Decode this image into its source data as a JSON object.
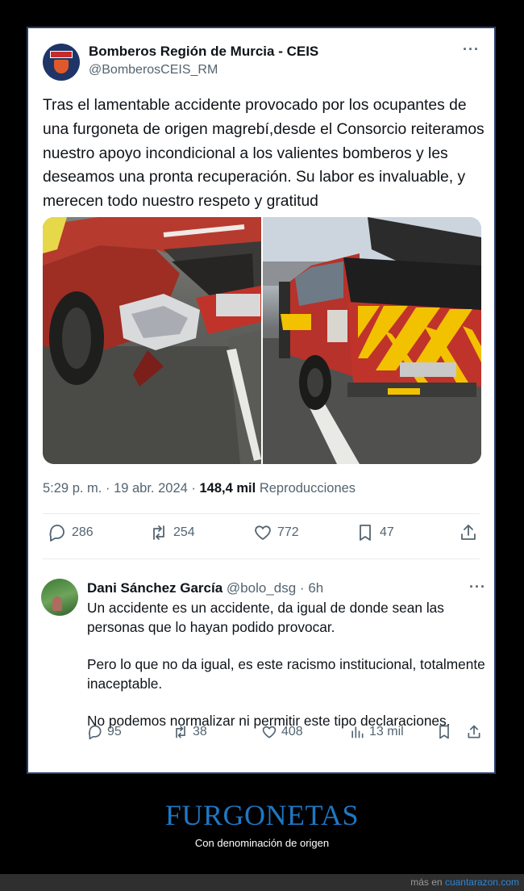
{
  "tweet": {
    "author_name": "Bomberos Región de Murcia - CEIS",
    "author_handle": "@BomberosCEIS_RM",
    "more_icon": "more-dots-icon",
    "text": "Tras el lamentable accidente provocado por los ocupantes de una furgoneta de origen magrebí,desde el Consorcio reiteramos nuestro apoyo incondicional a los valientes bomberos y les deseamos una pronta recuperación. Su labor es invaluable, y merecen todo nuestro respeto y gratitud",
    "time": "5:29 p. m.",
    "date": "19 abr. 2024",
    "views_count": "148,4 mil",
    "views_label": "Reproducciones",
    "actions": {
      "replies": "286",
      "retweets": "254",
      "likes": "772",
      "bookmarks": "47"
    }
  },
  "reply": {
    "author_name": "Dani Sánchez García",
    "author_handle": "@bolo_dsg",
    "time_ago": "6h",
    "paragraphs": [
      "Un accidente es un accidente, da igual de donde sean las personas que lo hayan podido provocar.",
      "Pero lo que no da igual, es este racismo institucional, totalmente inaceptable.",
      "No podemos normalizar ni permitir este tipo declaraciones."
    ],
    "actions": {
      "replies": "95",
      "retweets": "38",
      "likes": "408",
      "views": "13 mil"
    }
  },
  "caption": {
    "title": "FURGONETAS",
    "subtitle": "Con denominación de origen"
  },
  "footer": {
    "prefix": "más en",
    "site": "cuantarazon.com"
  },
  "colors": {
    "accent": "#1f77c4",
    "text": "#0f1419",
    "muted": "#536471",
    "truck_red": "#c0332b",
    "chevron_yellow": "#f2c200"
  }
}
